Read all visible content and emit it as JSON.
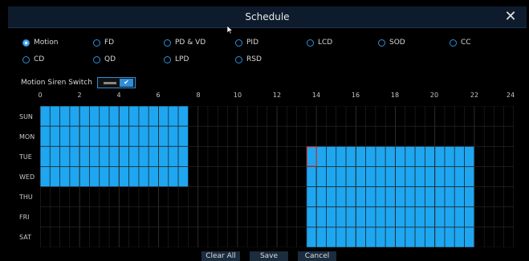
{
  "dialog": {
    "title": "Schedule"
  },
  "detection_types": [
    {
      "label": "Motion",
      "selected": true
    },
    {
      "label": "FD",
      "selected": false
    },
    {
      "label": "PD & VD",
      "selected": false
    },
    {
      "label": "PID",
      "selected": false
    },
    {
      "label": "LCD",
      "selected": false
    },
    {
      "label": "SOD",
      "selected": false
    },
    {
      "label": "CC",
      "selected": false
    },
    {
      "label": "CD",
      "selected": false
    },
    {
      "label": "QD",
      "selected": false
    },
    {
      "label": "LPD",
      "selected": false
    },
    {
      "label": "RSD",
      "selected": false
    }
  ],
  "siren": {
    "label": "Motion Siren Switch",
    "enabled": true
  },
  "hour_labels": [
    "0",
    "2",
    "4",
    "6",
    "8",
    "10",
    "12",
    "14",
    "16",
    "18",
    "20",
    "22",
    "24"
  ],
  "days": [
    "SUN",
    "MON",
    "TUE",
    "WED",
    "THU",
    "FRI",
    "SAT"
  ],
  "schedule": {
    "SUN": [
      [
        0,
        7.5
      ]
    ],
    "MON": [
      [
        0,
        7.5
      ]
    ],
    "TUE": [
      [
        0,
        7.5
      ],
      [
        13.5,
        22
      ]
    ],
    "WED": [
      [
        0,
        7.5
      ],
      [
        13.5,
        22
      ]
    ],
    "THU": [
      [
        13.5,
        22
      ]
    ],
    "FRI": [
      [
        13.5,
        22
      ]
    ],
    "SAT": [
      [
        13.5,
        22
      ]
    ]
  },
  "colors": {
    "active": "#1ea7f0",
    "active_border": "#0a3f66",
    "selection": "#e0302a",
    "grid": "#2b2b2b"
  },
  "buttons": {
    "clear_all": "Clear All",
    "save": "Save",
    "cancel": "Cancel"
  }
}
